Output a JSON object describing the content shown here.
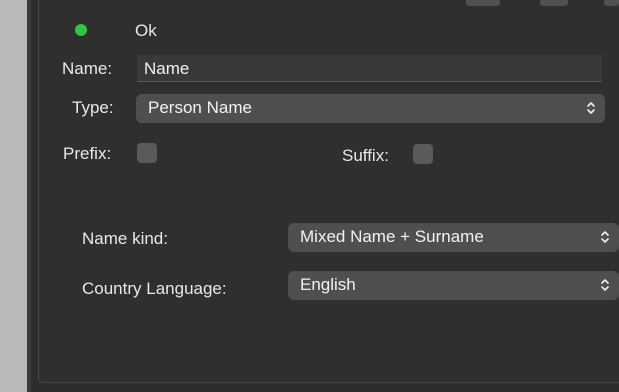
{
  "status": {
    "text": "Ok",
    "indicator_color": "#2bc840",
    "indicator_icon": "status-dot-icon"
  },
  "name": {
    "label": "Name:",
    "value": "Name"
  },
  "type": {
    "label": "Type:",
    "value": "Person Name"
  },
  "prefix": {
    "label": "Prefix:",
    "checked": false
  },
  "suffix": {
    "label": "Suffix:",
    "checked": false
  },
  "name_kind": {
    "label": "Name kind:",
    "value": "Mixed Name + Surname"
  },
  "country_language": {
    "label": "Country Language:",
    "value": "English"
  },
  "icons": {
    "popup_indicator": "up-down-chevron-icon"
  }
}
